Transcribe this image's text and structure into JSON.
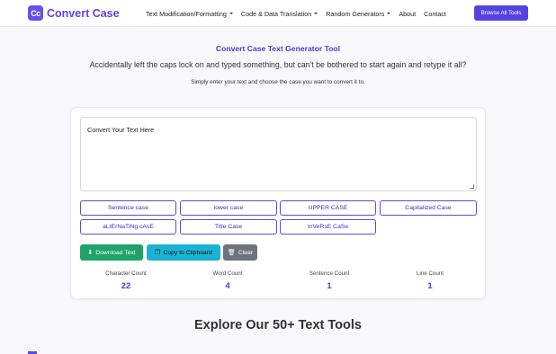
{
  "header": {
    "logo_badge": "Cc",
    "logo_text": "Convert Case",
    "nav": [
      {
        "label": "Text Modification/Formatting",
        "dropdown": true
      },
      {
        "label": "Code & Data Translation",
        "dropdown": true
      },
      {
        "label": "Random Generators",
        "dropdown": true
      },
      {
        "label": "About",
        "dropdown": false
      },
      {
        "label": "Contact",
        "dropdown": false
      }
    ],
    "browse_label": "Browse All Tools"
  },
  "intro": {
    "title": "Convert Case Text Generator Tool",
    "tagline": "Accidentally left the caps lock on and typed something, but can't be bothered to start again and retype it all?",
    "instruction": "Simply enter your text and choose the case you want to convert it to."
  },
  "editor": {
    "text_value": "Convert Your Text Here"
  },
  "case_buttons": [
    "Sentence case",
    "lower case",
    "UPPER CASE",
    "Capitalized Case",
    "aLtErNaTiNg cAsE",
    "Title Case",
    "InVeRsE CaSe"
  ],
  "actions": {
    "download": "Download Text",
    "copy": "Copy to Clipboard",
    "clear": "Clear"
  },
  "stats": [
    {
      "label": "Character Count",
      "value": "22"
    },
    {
      "label": "Word Count",
      "value": "4"
    },
    {
      "label": "Sentence Count",
      "value": "1"
    },
    {
      "label": "Line Count",
      "value": "1"
    }
  ],
  "explore_heading": "Explore Our 50+ Text Tools",
  "colors": {
    "brand": "#5443e0",
    "download": "#1fa36a",
    "copy": "#1bb3d4",
    "clear": "#6c757d"
  }
}
